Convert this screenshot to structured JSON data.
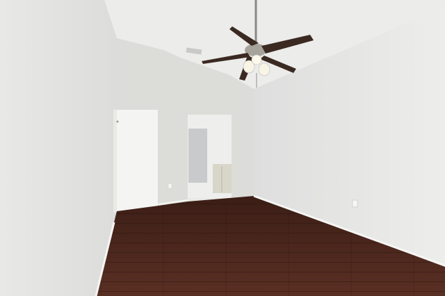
{
  "scene": {
    "ceiling_fan": {
      "blade_count": 5,
      "light_count": 3
    },
    "colors": {
      "ceiling": "#ececea",
      "left_wall": "#e4e4e2",
      "right_wall": "#e9e9e7",
      "back_wall": "#dcdcd8",
      "floor_dark": "#3a1c14",
      "floor_mid": "#5a2e22",
      "door": "#f4f4f2",
      "fan_blade": "#3b2a22",
      "baseboard": "#f5f5f3"
    }
  }
}
